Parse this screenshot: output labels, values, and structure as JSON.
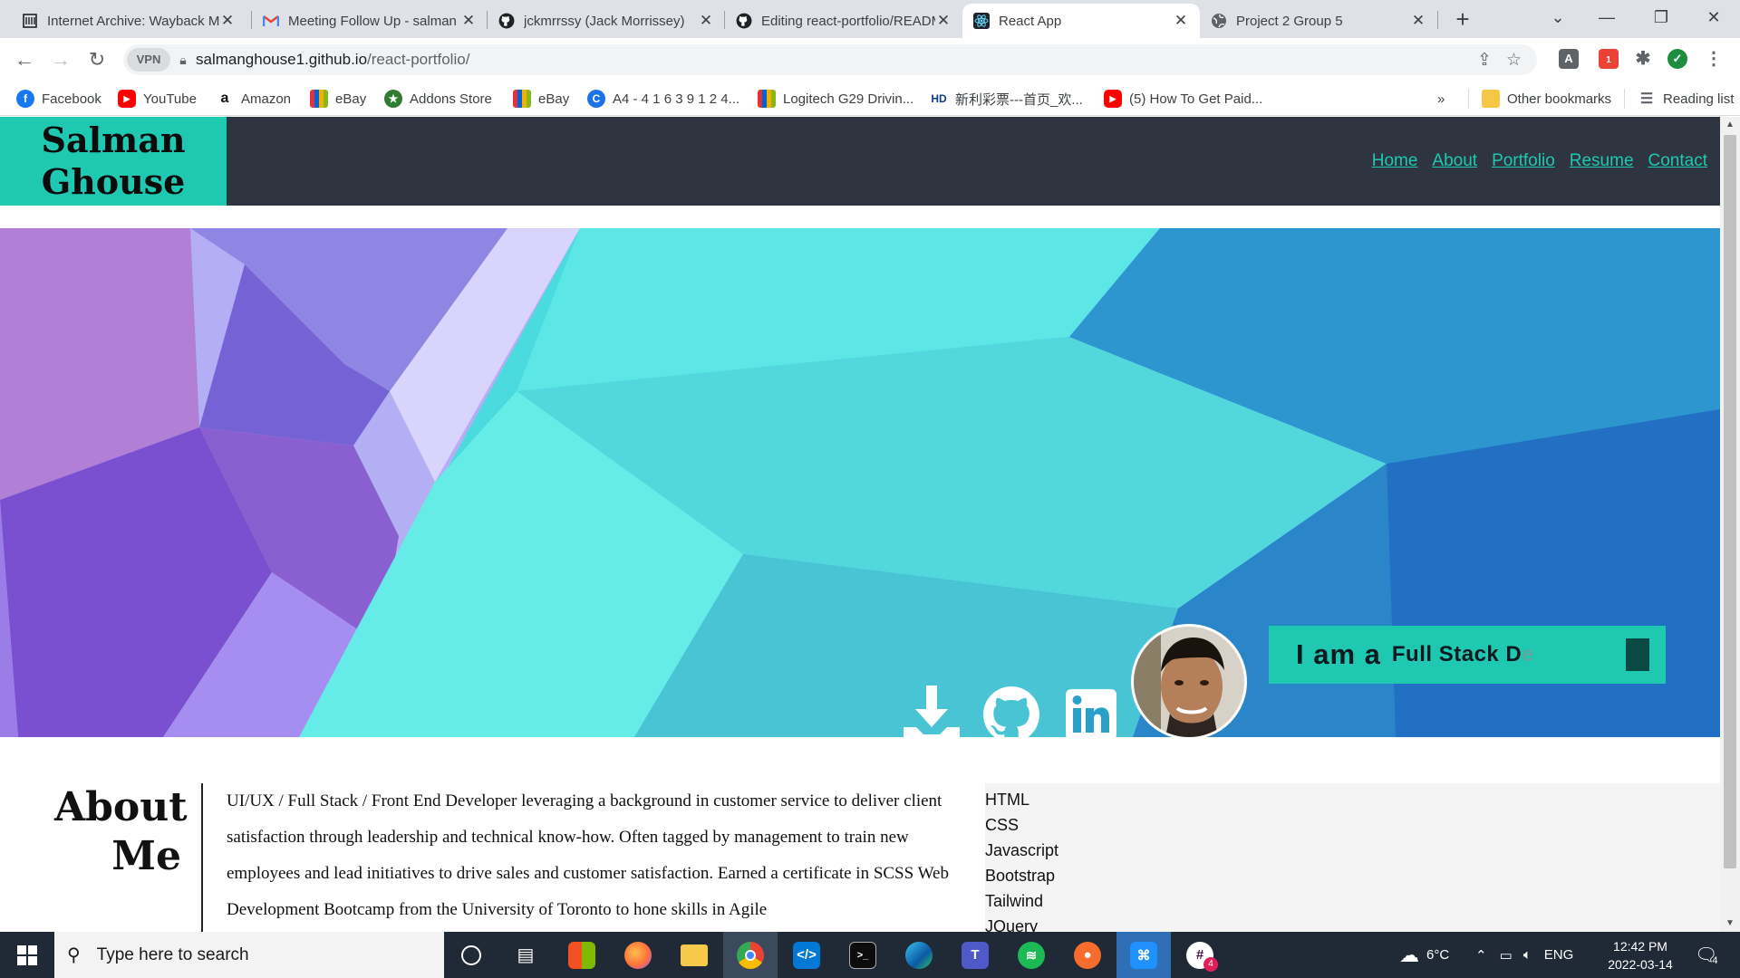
{
  "browser": {
    "tabs": [
      {
        "title": "Internet Archive: Wayback Machine",
        "icon": "archive-icon",
        "active": false
      },
      {
        "title": "Meeting Follow Up - salman",
        "icon": "gmail-icon",
        "active": false
      },
      {
        "title": "jckmrrssy (Jack Morrissey)",
        "icon": "github-icon",
        "active": false
      },
      {
        "title": "Editing react-portfolio/README",
        "icon": "github-icon",
        "active": false
      },
      {
        "title": "React App",
        "icon": "react-icon",
        "active": true
      },
      {
        "title": "Project 2 Group 5",
        "icon": "globe-icon",
        "active": false
      }
    ],
    "new_tab_label": "+",
    "vpn_label": "VPN",
    "url_host": "salmanghouse1.github.io",
    "url_path": "/react-portfolio/",
    "extension_badge": "1",
    "bookmarks": [
      {
        "label": "Facebook",
        "icon": "facebook-icon",
        "color": "#1877f2",
        "glyph": "f"
      },
      {
        "label": "YouTube",
        "icon": "youtube-icon",
        "color": "#ff0000",
        "glyph": "▶"
      },
      {
        "label": "Amazon",
        "icon": "amazon-icon",
        "color": "#111111",
        "glyph": "a"
      },
      {
        "label": "eBay",
        "icon": "shopping-bag-icon",
        "color": "#e53238",
        "glyph": "e"
      },
      {
        "label": "Addons Store",
        "icon": "addons-icon",
        "color": "#2e7d32",
        "glyph": "★"
      },
      {
        "label": "eBay",
        "icon": "shopping-bag-icon",
        "color": "#e53238",
        "glyph": "e"
      },
      {
        "label": "A4 - 4 1 6 3 9 1 2 4...",
        "icon": "c-icon",
        "color": "#1a73e8",
        "glyph": "C"
      },
      {
        "label": "Logitech G29 Drivin...",
        "icon": "shopping-bag-icon",
        "color": "#e53238",
        "glyph": "e"
      },
      {
        "label": "新利彩票---首页_欢...",
        "icon": "hd-icon",
        "color": "#0b57d0",
        "glyph": "HD"
      },
      {
        "label": "(5) How To Get Paid...",
        "icon": "youtube-icon",
        "color": "#ff0000",
        "glyph": "▶"
      }
    ],
    "more_bookmarks": "»",
    "other_bookmarks": "Other bookmarks",
    "reading_list": "Reading list"
  },
  "site": {
    "logo_line1": "Salman",
    "logo_line2": "Ghouse",
    "nav": [
      "Home",
      "About",
      "Portfolio",
      "Resume",
      "Contact"
    ],
    "hero": {
      "typing_lead": "I am a",
      "typing_role": "Full Stack D",
      "typing_ghost": "e"
    },
    "about": {
      "title_line1": "About",
      "title_line2": "Me",
      "paragraph": "UI/UX / Full Stack / Front End Developer leveraging a background in customer service to deliver client satisfaction through leadership and technical know-how. Often tagged by management to train new employees and lead initiatives to drive sales and customer satisfaction. Earned a certificate in SCSS Web Development Bootcamp from the University of Toronto to hone skills in Agile"
    },
    "skills": [
      "HTML",
      "CSS",
      "Javascript",
      "Bootstrap",
      "Tailwind",
      "JQuery"
    ]
  },
  "taskbar": {
    "search_placeholder": "Type here to search",
    "weather": "6°C",
    "language": "ENG",
    "time": "12:42 PM",
    "date": "2022-03-14",
    "notification_count": "4",
    "slack_badge": "4"
  },
  "colors": {
    "accent": "#1fc8b0",
    "header_bg": "#2e3440",
    "taskbar_bg": "#1f2a36"
  }
}
